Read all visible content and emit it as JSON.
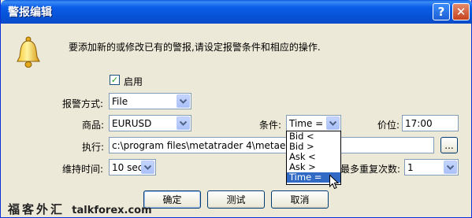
{
  "window": {
    "title": "警报编辑",
    "help_glyph": "?",
    "close_glyph": "✕"
  },
  "intro_text": "要添加新的或修改已有的警报,请设定报警条件和相应的操作.",
  "enable": {
    "label": "启用",
    "checked": true
  },
  "alert_type": {
    "label": "报警方式:",
    "value": "File"
  },
  "symbol": {
    "label": "商品:",
    "value": "EURUSD"
  },
  "condition": {
    "label": "条件:",
    "value": "Time =",
    "options": [
      "Bid <",
      "Bid >",
      "Ask <",
      "Ask >",
      "Time ="
    ],
    "highlighted": "Time ="
  },
  "price": {
    "label": "价位:",
    "value": "17:00"
  },
  "execute": {
    "label": "执行:",
    "value": "c:\\program files\\metatrader 4\\metaeditor.exe",
    "browse_label": "..."
  },
  "timeout": {
    "label": "维持时间:",
    "value": "10 sec"
  },
  "max_iterations": {
    "label": "最多重复次数:",
    "value": "1"
  },
  "buttons": {
    "ok": "确定",
    "test": "测试",
    "cancel": "取消"
  },
  "watermark": {
    "text_cn": "福客外汇",
    "text_site": "talkforex.com"
  },
  "colors": {
    "title_bar": "#0552d6",
    "selection": "#316ac5",
    "dialog_bg": "#ece9d8"
  }
}
